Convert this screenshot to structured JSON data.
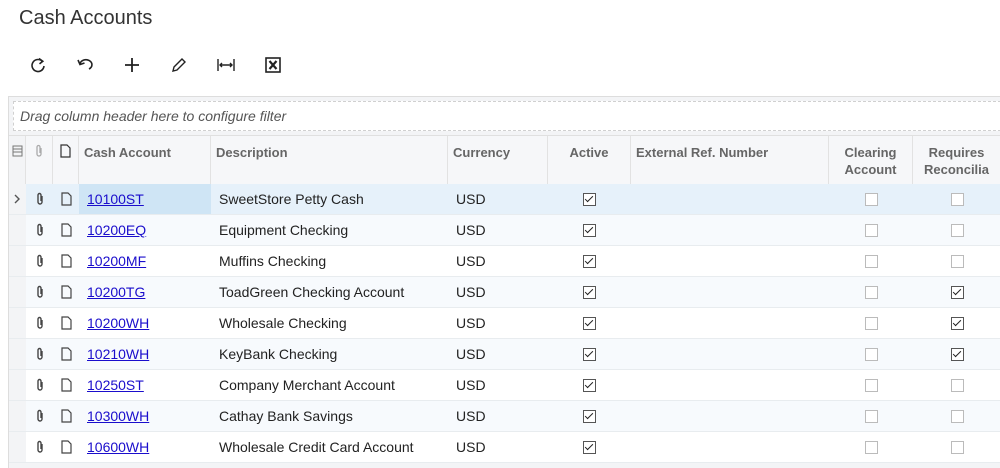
{
  "page_title": "Cash Accounts",
  "toolbar": [
    {
      "name": "refresh-button",
      "icon": "refresh-icon"
    },
    {
      "name": "undo-button",
      "icon": "undo-icon"
    },
    {
      "name": "add-button",
      "icon": "plus-icon"
    },
    {
      "name": "edit-button",
      "icon": "pencil-icon"
    },
    {
      "name": "fit-columns-button",
      "icon": "fit-width-icon"
    },
    {
      "name": "export-excel-button",
      "icon": "excel-icon"
    }
  ],
  "filter_placeholder": "Drag column header here to configure filter",
  "columns": {
    "cash_account": "Cash Account",
    "description": "Description",
    "currency": "Currency",
    "active": "Active",
    "ext_ref": "External Ref. Number",
    "clearing": "Clearing Account",
    "requires": "Requires Reconcilia"
  },
  "rows": [
    {
      "account": "10100ST",
      "description": "SweetStore Petty Cash",
      "currency": "USD",
      "active": true,
      "clearing": false,
      "requires": false,
      "selected": true
    },
    {
      "account": "10200EQ",
      "description": "Equipment Checking",
      "currency": "USD",
      "active": true,
      "clearing": false,
      "requires": false
    },
    {
      "account": "10200MF",
      "description": "Muffins Checking",
      "currency": "USD",
      "active": true,
      "clearing": false,
      "requires": false
    },
    {
      "account": "10200TG",
      "description": "ToadGreen Checking Account",
      "currency": "USD",
      "active": true,
      "clearing": false,
      "requires": true
    },
    {
      "account": "10200WH",
      "description": "Wholesale Checking",
      "currency": "USD",
      "active": true,
      "clearing": false,
      "requires": true
    },
    {
      "account": "10210WH",
      "description": "KeyBank Checking",
      "currency": "USD",
      "active": true,
      "clearing": false,
      "requires": true
    },
    {
      "account": "10250ST",
      "description": "Company Merchant Account",
      "currency": "USD",
      "active": true,
      "clearing": false,
      "requires": false
    },
    {
      "account": "10300WH",
      "description": "Cathay Bank Savings",
      "currency": "USD",
      "active": true,
      "clearing": false,
      "requires": false
    },
    {
      "account": "10600WH",
      "description": "Wholesale Credit Card Account",
      "currency": "USD",
      "active": true,
      "clearing": false,
      "requires": false
    }
  ]
}
